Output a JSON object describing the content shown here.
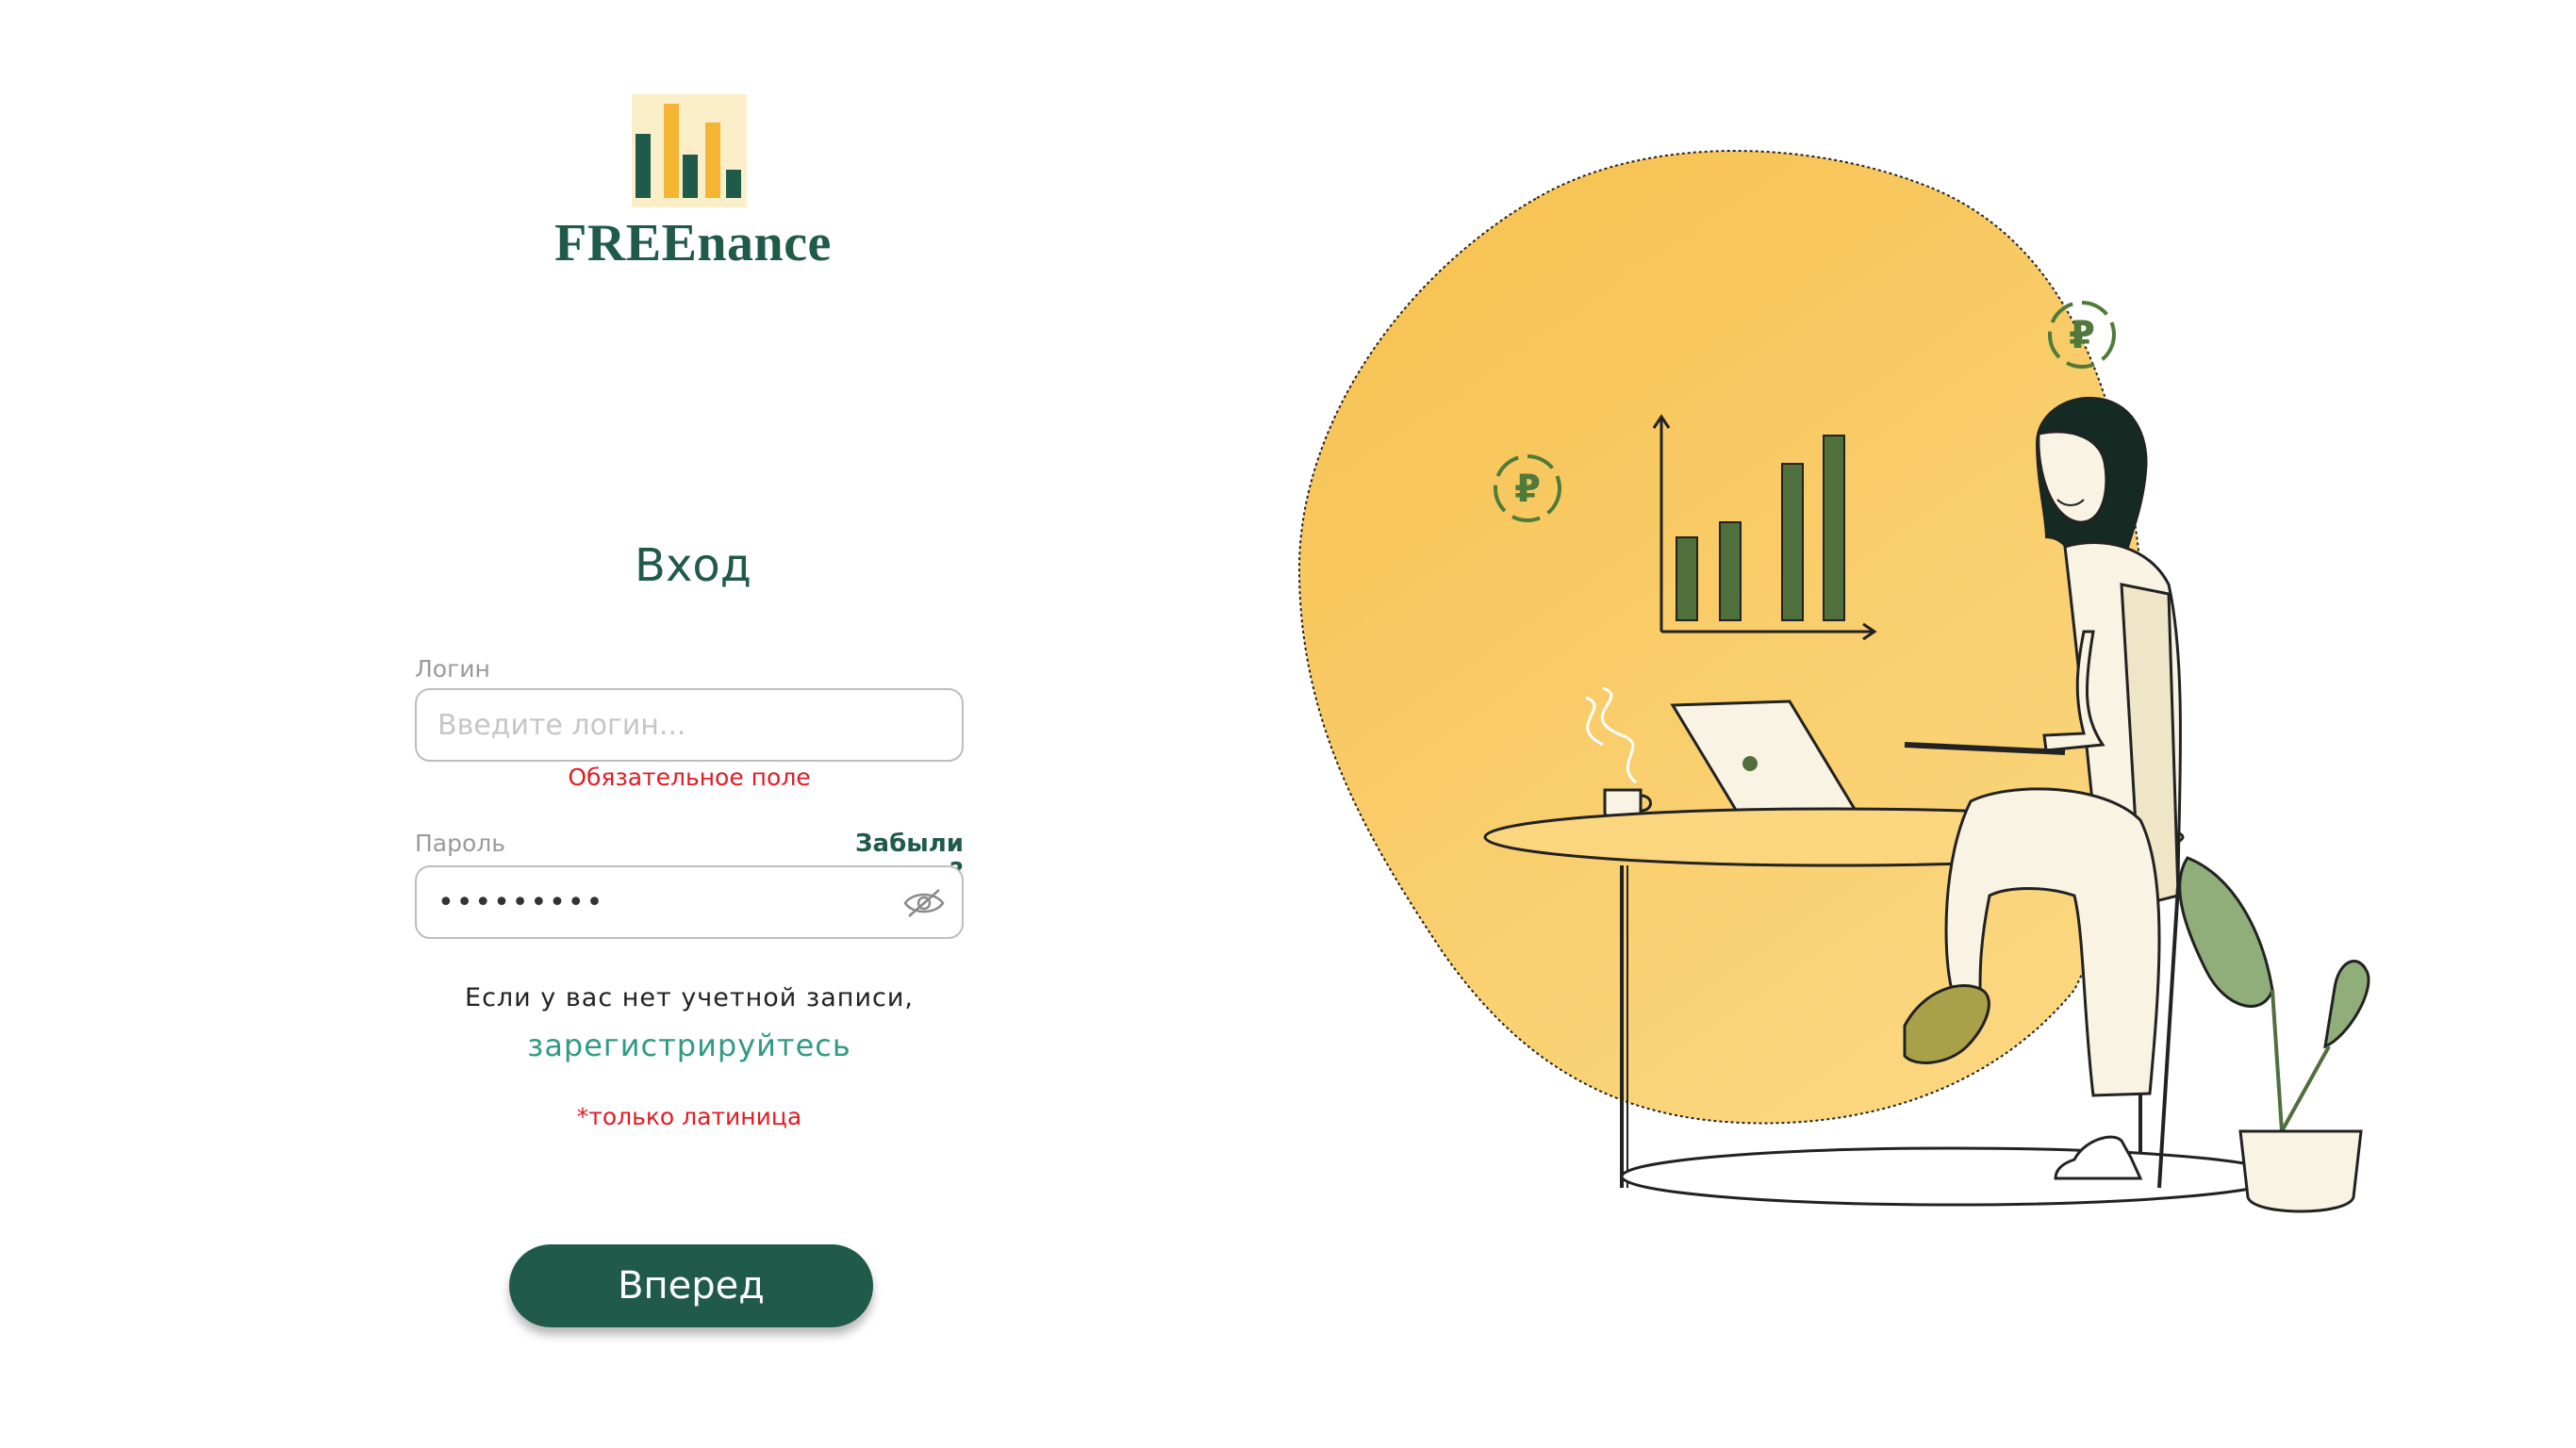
{
  "brand": {
    "name": "FREEnance",
    "logo_icon": "bar-chart-logo-icon",
    "colors": {
      "primary": "#1f5a4b",
      "accent": "#f4b534",
      "error": "#e31b23",
      "link": "#2f9b85"
    }
  },
  "login_form": {
    "title": "Вход",
    "login": {
      "label": "Логин",
      "placeholder": "Введите логин...",
      "value": "",
      "error": "Обязательное поле"
    },
    "password": {
      "label": "Пароль",
      "value": "•••••••••",
      "forgot_link": "Забыли пароль?",
      "toggle_icon": "eye-off-icon"
    },
    "no_account_text": "Если у вас нет учетной записи,",
    "register_link": "зарегистрируйтесь",
    "latin_only_note": "*только латиница",
    "submit_label": "Вперед"
  },
  "illustration": {
    "icons": [
      "ruble-coin-icon",
      "bar-chart-icon",
      "laptop-icon",
      "coffee-cup-icon",
      "plant-icon"
    ]
  }
}
